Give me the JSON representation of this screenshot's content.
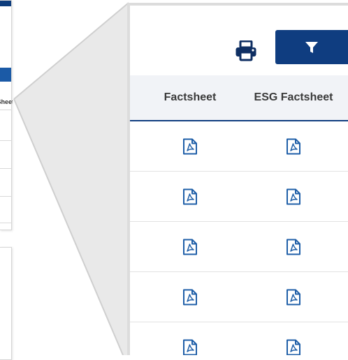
{
  "background": {
    "header_fragment": "Sheet"
  },
  "toolbar": {
    "print_icon": "printer-icon",
    "filter_icon": "filter-icon",
    "filter_button_color": "#0f3d80"
  },
  "table": {
    "columns": [
      "Factsheet",
      "ESG Factsheet"
    ],
    "cell_icon": "pdf-file-icon",
    "icon_color": "#1f5fa8",
    "visible_rows": 5
  }
}
